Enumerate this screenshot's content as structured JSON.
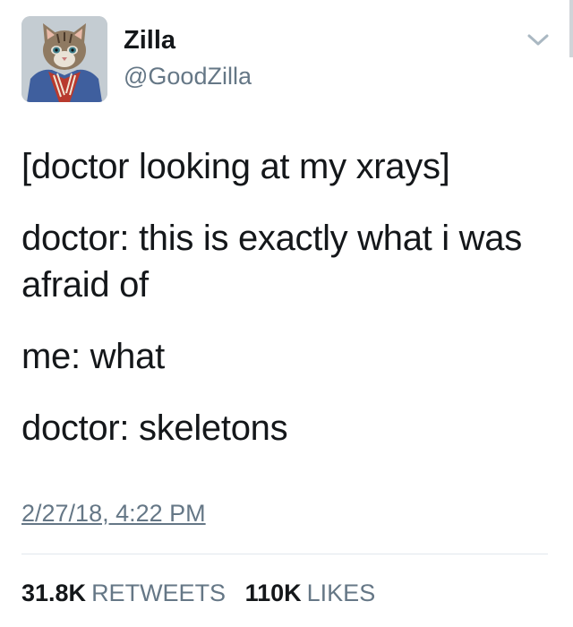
{
  "user": {
    "display_name": "Zilla",
    "handle": "@GoodZilla",
    "avatar_icon": "cat-in-jacket-avatar"
  },
  "tweet": {
    "lines": [
      "[doctor looking at my xrays]",
      "doctor: this is exactly what i was afraid of",
      "me: what",
      "doctor: skeletons"
    ],
    "timestamp": "2/27/18, 4:22 PM"
  },
  "stats": {
    "retweets_count": "31.8K",
    "retweets_label": "RETWEETS",
    "likes_count": "110K",
    "likes_label": "LIKES"
  },
  "icons": {
    "menu": "chevron-down-icon"
  },
  "colors": {
    "text": "#14171a",
    "secondary": "#657786",
    "divider": "#e1e8ed"
  }
}
